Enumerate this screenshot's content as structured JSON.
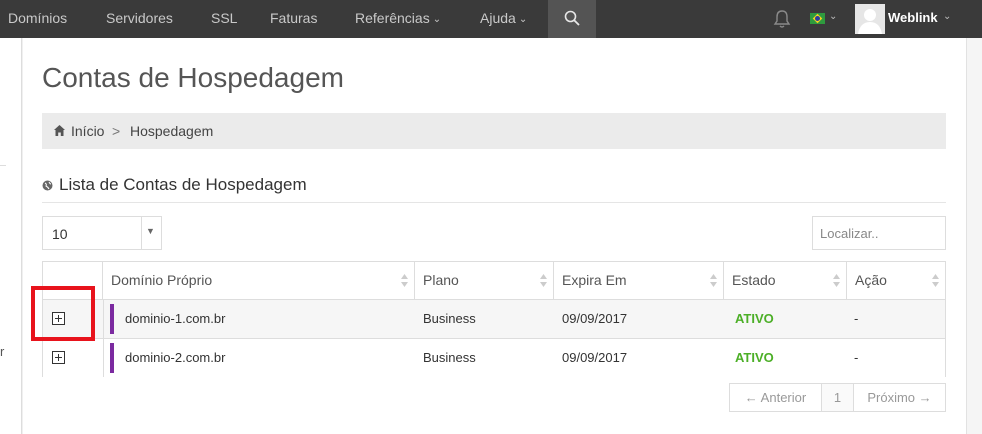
{
  "nav": {
    "items": [
      "Domínios",
      "Servidores",
      "SSL",
      "Faturas",
      "Referências",
      "Ajuda"
    ],
    "search_icon": "search-icon",
    "notifications_icon": "bell-icon",
    "language_flag": "brazil-flag-icon",
    "user_name": "Weblink"
  },
  "left_strip": {
    "letter": "r"
  },
  "page": {
    "title": "Contas de Hospedagem",
    "breadcrumb": {
      "home": "Início",
      "separator": ">",
      "current": "Hospedagem"
    },
    "section_title": "Lista de Contas de Hospedagem"
  },
  "controls": {
    "page_length": "10",
    "search_placeholder": "Localizar.."
  },
  "table": {
    "columns": [
      "Domínio Próprio",
      "Plano",
      "Expira Em",
      "Estado",
      "Ação"
    ],
    "rows": [
      {
        "domain": "dominio-1.com.br",
        "plan": "Business",
        "expires": "09/09/2017",
        "status": "ATIVO",
        "action": "-"
      },
      {
        "domain": "dominio-2.com.br",
        "plan": "Business",
        "expires": "09/09/2017",
        "status": "ATIVO",
        "action": "-"
      }
    ],
    "status_color": "#4caf27",
    "domain_marker_color": "#7b2aa0"
  },
  "pagination": {
    "prev": "← Anterior",
    "page": "1",
    "next": "Próximo →"
  },
  "annotation": {
    "highlight_color": "#e8131c"
  }
}
